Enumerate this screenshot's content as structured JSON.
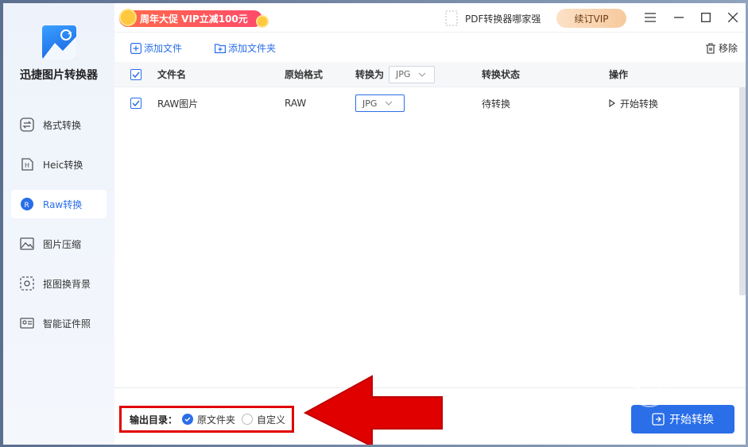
{
  "app": {
    "name": "迅捷图片转换器"
  },
  "sidebar": {
    "items": [
      {
        "label": "格式转换",
        "icon": "swap-icon",
        "active": false
      },
      {
        "label": "Heic转换",
        "icon": "heic-icon",
        "active": false
      },
      {
        "label": "Raw转换",
        "icon": "raw-icon",
        "active": true
      },
      {
        "label": "图片压缩",
        "icon": "image-compress-icon",
        "active": false
      },
      {
        "label": "抠图换背景",
        "icon": "cutout-icon",
        "active": false
      },
      {
        "label": "智能证件照",
        "icon": "id-photo-icon",
        "active": false
      }
    ]
  },
  "topbar": {
    "promo": "周年大促 VIP立减100元",
    "pdf_link": "PDF转换器哪家强",
    "vip_button": "续订VIP"
  },
  "toolbar": {
    "add_file": "添加文件",
    "add_folder": "添加文件夹",
    "remove": "移除"
  },
  "table": {
    "headers": {
      "filename": "文件名",
      "original_format": "原始格式",
      "convert_to": "转换为",
      "status": "转换状态",
      "action": "操作"
    },
    "header_select": "JPG",
    "rows": [
      {
        "filename": "RAW图片",
        "format": "RAW",
        "target": "JPG",
        "status": "待转换",
        "action": "开始转换"
      }
    ]
  },
  "footer": {
    "output_label": "输出目录：",
    "option_original": "原文件夹",
    "option_custom": "自定义",
    "start_button": "开始转换"
  },
  "colors": {
    "accent": "#2a6ee8",
    "highlight": "#e00000"
  }
}
